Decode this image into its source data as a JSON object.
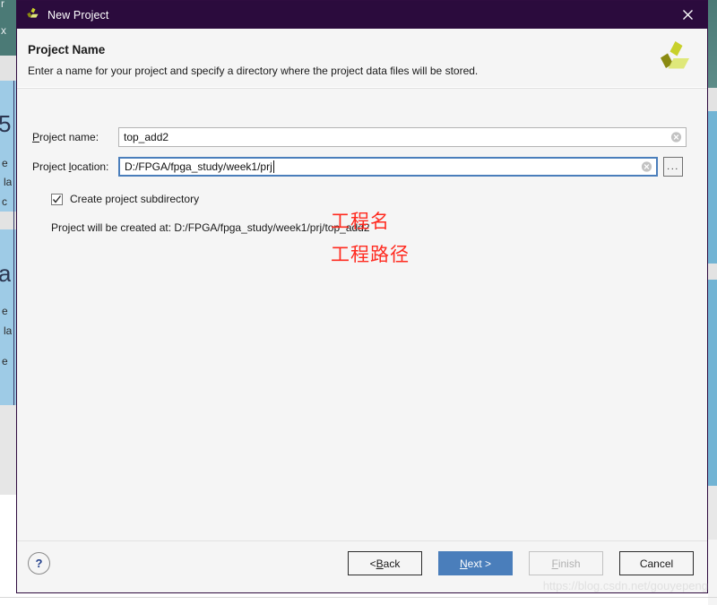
{
  "window": {
    "title": "New Project",
    "logo_icon": "vivado-logo-icon",
    "close_icon": "close-icon",
    "title_bar_color": "#2b0b3d"
  },
  "header": {
    "title": "Project Name",
    "subtitle": "Enter a name for your project and specify a directory where the project data files will be stored.",
    "logo_icon": "vivado-logo-icon"
  },
  "form": {
    "name_field": {
      "label_pre": "",
      "label_accel": "P",
      "label_post": "roject name:",
      "value": "top_add2",
      "clear_icon": "clear-circle-x-icon"
    },
    "location_field": {
      "label_pre": "Project ",
      "label_accel": "l",
      "label_post": "ocation:",
      "value": "D:/FPGA/fpga_study/week1/prj",
      "clear_icon": "clear-circle-x-icon",
      "browse_label": "...",
      "focused": true
    },
    "subdirectory_checkbox": {
      "label": "Create project subdirectory",
      "checked": true,
      "check_icon": "checkmark-icon"
    },
    "created_at_text": "Project will be created at: D:/FPGA/fpga_study/week1/prj/top_add2"
  },
  "annotations": [
    {
      "text": "工程名",
      "color": "#ff2b20"
    },
    {
      "text": "工程路径",
      "color": "#ff2b20"
    }
  ],
  "footer": {
    "help_label": "?",
    "help_icon": "question-mark-icon",
    "buttons": [
      {
        "pre": "< ",
        "accel": "B",
        "post": "ack",
        "state": "normal"
      },
      {
        "pre": "",
        "accel": "N",
        "post": "ext >",
        "state": "primary"
      },
      {
        "pre": "",
        "accel": "F",
        "post": "inish",
        "state": "disabled"
      },
      {
        "pre": "",
        "accel": "",
        "post": "Cancel",
        "state": "normal"
      }
    ]
  },
  "watermark": "https://blog.csdn.net/gouyepeng",
  "background_fragments": {
    "r": "r",
    "x": "x",
    "five": "5",
    "e1": "e",
    "la": "la",
    "c": "c",
    "a": "a",
    "e2": "e",
    "la2": "la",
    "e3": "e"
  }
}
